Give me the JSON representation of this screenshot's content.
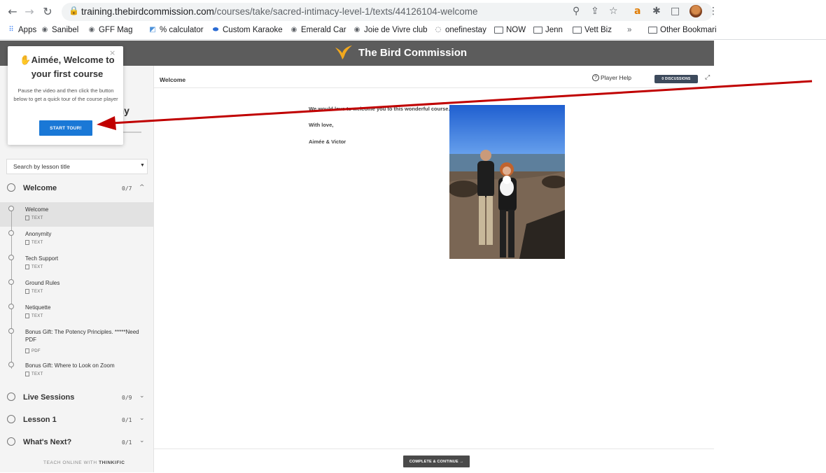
{
  "browser": {
    "url_domain": "training.thebirdcommission.com",
    "url_path": "/courses/take/sacred-intimacy-level-1/texts/44126104-welcome"
  },
  "bookmarks": {
    "items": [
      "Apps",
      "Sanibel",
      "GFF Mag",
      "% calculator",
      "Custom Karaoke",
      "Emerald Car",
      "Joie de Vivre club",
      "onefinestay",
      "NOW",
      "Jenn",
      "Vett Biz"
    ],
    "overflow": "»",
    "other": "Other Bookmari"
  },
  "header": {
    "brand": "The Bird Commission"
  },
  "popup": {
    "title": "Aimée, Welcome to your first course",
    "body": "Pause the video and then click the button below to get a quick tour of the course player",
    "button": "START TOUR!",
    "close": "×"
  },
  "sidebar": {
    "course_title_fragment": "d\nony",
    "search_placeholder": "Search by lesson title",
    "chapters": [
      {
        "title": "Welcome",
        "count": "0/7",
        "expanded": true
      },
      {
        "title": "Live Sessions",
        "count": "0/9",
        "expanded": false
      },
      {
        "title": "Lesson 1",
        "count": "0/1",
        "expanded": false
      },
      {
        "title": "What's Next?",
        "count": "0/1",
        "expanded": false
      }
    ],
    "lessons": [
      {
        "title": "Welcome",
        "type": "TEXT"
      },
      {
        "title": "Anonymity",
        "type": "TEXT"
      },
      {
        "title": "Tech Support",
        "type": "TEXT"
      },
      {
        "title": "Ground Rules",
        "type": "TEXT"
      },
      {
        "title": "Netiquette",
        "type": "TEXT"
      },
      {
        "title": "Bonus Gift: The Potency Principles. *****Need PDF",
        "type": "PDF"
      },
      {
        "title": "Bonus Gift: Where to Look on Zoom",
        "type": "TEXT"
      }
    ],
    "footer_prefix": "TEACH ONLINE WITH",
    "footer_brand": "THINKIFIC"
  },
  "content": {
    "title": "Welcome",
    "player_help": "Player Help",
    "discussions": "0 DISCUSSIONS",
    "lines": [
      "We would love to welcome you to this wonderful course.",
      "With love,",
      "Aimée & Victor"
    ],
    "complete_button": "COMPLETE & CONTINUE →"
  },
  "colors": {
    "header": "#5c5c5c",
    "tour_button": "#1a78d6",
    "arrow": "#c00000"
  }
}
